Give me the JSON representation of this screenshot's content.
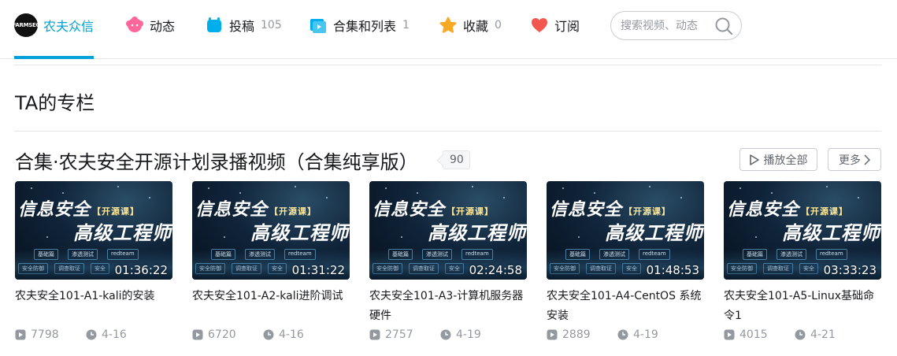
{
  "nav": {
    "home": {
      "logo_text": "FARMSEC",
      "label": "农夫众信"
    },
    "items": [
      {
        "label": "动态",
        "count": ""
      },
      {
        "label": "投稿",
        "count": "105"
      },
      {
        "label": "合集和列表",
        "count": "1"
      },
      {
        "label": "收藏",
        "count": "0"
      },
      {
        "label": "订阅",
        "count": ""
      }
    ],
    "search_placeholder": "搜索视频、动态"
  },
  "section": {
    "title": "TA的专栏"
  },
  "collection": {
    "title": "合集·农夫安全开源计划录播视频（合集纯享版）",
    "count": "90",
    "play_all_label": "播放全部",
    "more_label": "更多"
  },
  "thumbnail_text": {
    "line1": "信息安全",
    "badge": "【开源课】",
    "line2": "高级工程师",
    "tags": [
      "基础篇",
      "渗透测试",
      "redteam"
    ],
    "tags2": [
      "安全防御",
      "调查取证",
      "安全"
    ]
  },
  "videos": [
    {
      "title": "农夫安全101-A1-kali的安装",
      "duration": "01:36:22",
      "plays": "7798",
      "date": "4-16"
    },
    {
      "title": "农夫安全101-A2-kali进阶调试",
      "duration": "01:31:22",
      "plays": "6720",
      "date": "4-16"
    },
    {
      "title": "农夫安全101-A3-计算机服务器硬件",
      "duration": "02:24:58",
      "plays": "2757",
      "date": "4-19"
    },
    {
      "title": "农夫安全101-A4-CentOS 系统安装",
      "duration": "01:48:53",
      "plays": "2889",
      "date": "4-19"
    },
    {
      "title": "农夫安全101-A5-Linux基础命令1",
      "duration": "03:33:23",
      "plays": "4015",
      "date": "4-21"
    }
  ],
  "colors": {
    "accent": "#00a1d6",
    "text": "#18191c",
    "muted": "#9499a0",
    "border": "#e3e5e7"
  }
}
